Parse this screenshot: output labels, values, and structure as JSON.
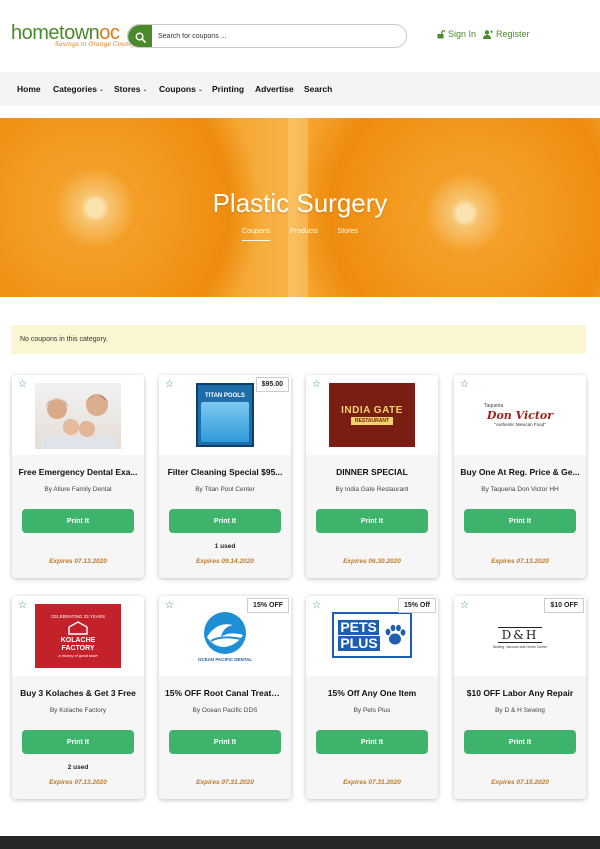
{
  "header": {
    "logo_main": "hometown",
    "logo_accent": "oc",
    "logo_tagline": "Savings in Orange County",
    "search_placeholder": "Search for coupons ...",
    "sign_in": "Sign In",
    "register": "Register"
  },
  "nav": [
    {
      "label": "Home",
      "caret": false
    },
    {
      "label": "Categories",
      "caret": true
    },
    {
      "label": "Stores",
      "caret": true
    },
    {
      "label": "Coupons",
      "caret": true
    },
    {
      "label": "Printing",
      "caret": false
    },
    {
      "label": "Advertise",
      "caret": false
    },
    {
      "label": "Search",
      "caret": false
    }
  ],
  "hero": {
    "title": "Plastic Surgery",
    "tabs": [
      "Coupons",
      "Products",
      "Stores"
    ]
  },
  "alert": "No coupons in this category.",
  "cards": [
    {
      "title": "Free Emergency Dental Exa...",
      "by": "By Allure Family Dental",
      "button": "Print It",
      "used": "",
      "expires": "Expires 07.13.2020",
      "badge": "",
      "image": "family-photo"
    },
    {
      "title": "Filter Cleaning Special $95...",
      "by": "By Titan Pool Center",
      "button": "Print It",
      "used": "1 used",
      "expires": "Expires 09.14.2020",
      "badge": "$95.00",
      "image": "titan-pools-logo",
      "image_text": "TITAN POOLS"
    },
    {
      "title": "DINNER SPECIAL",
      "by": "By India Gate Restaurant",
      "button": "Print It",
      "used": "",
      "expires": "Expires 06.30.2020",
      "badge": "",
      "image": "india-gate-logo",
      "image_text": "INDIA GATE",
      "image_sub": "RESTAURANT"
    },
    {
      "title": "Buy One At Reg. Price & Ge...",
      "by": "By Taqueria Don Victor HH",
      "button": "Print It",
      "used": "",
      "expires": "Expires 07.13.2020",
      "badge": "",
      "image": "don-victor-logo",
      "image_text": "Don Victor",
      "image_pre": "Taqueria",
      "image_sub": "\"Authentic Mexican Food\""
    },
    {
      "title": "Buy 3 Kolaches & Get 3 Free",
      "by": "By Kolache Factory",
      "button": "Print It",
      "used": "2 used",
      "expires": "Expires 07.13.2020",
      "badge": "",
      "image": "kolache-factory-logo",
      "image_pre": "CELEBRATING 33 YEARS",
      "image_text": "KOLACHE FACTORY",
      "image_sub": "a history of good taste"
    },
    {
      "title": "15% OFF Root Canal Treatm...",
      "by": "By Ocean Pacific DDS",
      "button": "Print It",
      "used": "",
      "expires": "Expires 07.31.2020",
      "badge": "15% OFF",
      "image": "ocean-pacific-logo",
      "image_text": "OCEAN PACIFIC DENTAL"
    },
    {
      "title": "15% Off Any One Item",
      "by": "By Pets Plus",
      "button": "Print It",
      "used": "",
      "expires": "Expires 07.31.2020",
      "badge": "15% Off",
      "image": "pets-plus-logo",
      "image_text": "PETS",
      "image_sub": "PLUS"
    },
    {
      "title": "$10 OFF Labor Any Repair",
      "by": "By D & H Sewing",
      "button": "Print It",
      "used": "",
      "expires": "Expires 07.15.2020",
      "badge": "$10 OFF",
      "image": "dh-sewing-logo",
      "image_text": "D&H",
      "image_sub": "Sewing, Vacuum and Home Center"
    }
  ],
  "colors": {
    "brand_green": "#4a8a2a",
    "brand_orange": "#e07a1c",
    "button_green": "#3db36c",
    "expires": "#c07a2a"
  }
}
